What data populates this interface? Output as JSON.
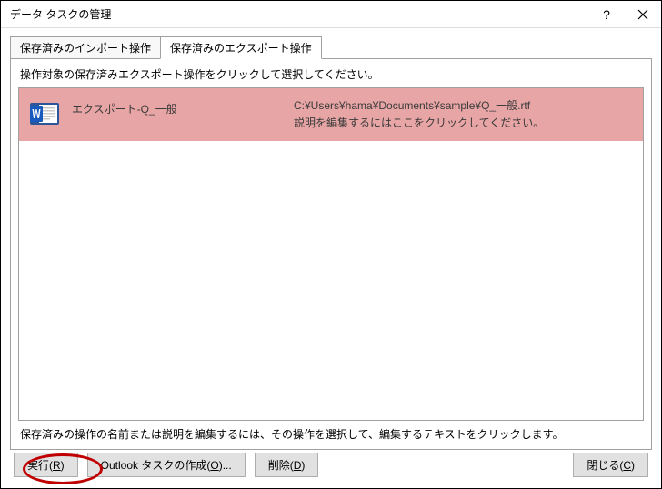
{
  "window": {
    "title": "データ タスクの管理"
  },
  "tabs": {
    "import": "保存済みのインポート操作",
    "export": "保存済みのエクスポート操作"
  },
  "panel": {
    "instruction": "操作対象の保存済みエクスポート操作をクリックして選択してください。",
    "hint": "保存済みの操作の名前または説明を編集するには、その操作を選択して、編集するテキストをクリックします。"
  },
  "rows": [
    {
      "name": "エクスポート-Q_一般",
      "path": "C:¥Users¥hama¥Documents¥sample¥Q_一般.rtf",
      "desc": "説明を編集するにはここをクリックしてください。",
      "icon": "word-doc-icon"
    }
  ],
  "buttons": {
    "run": "実行(R)",
    "outlook": "Outlook タスクの作成(O)...",
    "delete": "削除(D)",
    "close": "閉じる(C)"
  }
}
